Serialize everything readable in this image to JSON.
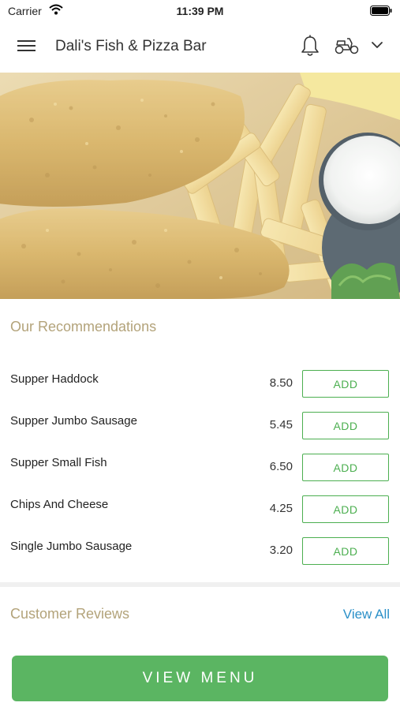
{
  "status_bar": {
    "carrier": "Carrier",
    "time": "11:39 PM"
  },
  "app_bar": {
    "title": "Dali's Fish & Pizza Bar"
  },
  "recommendations": {
    "title": "Our Recommendations",
    "items": [
      {
        "name": "Supper Haddock",
        "price": "8.50",
        "button": "ADD"
      },
      {
        "name": "Supper Jumbo Sausage",
        "price": "5.45",
        "button": "ADD"
      },
      {
        "name": "Supper Small Fish",
        "price": "6.50",
        "button": "ADD"
      },
      {
        "name": "Chips And Cheese",
        "price": "4.25",
        "button": "ADD"
      },
      {
        "name": "Single Jumbo Sausage",
        "price": "3.20",
        "button": "ADD"
      }
    ]
  },
  "reviews": {
    "title": "Customer Reviews",
    "view_all": "View All"
  },
  "footer": {
    "view_menu": "VIEW MENU"
  },
  "colors": {
    "accent_green": "#5bb562",
    "section_title": "#b3a37a",
    "link_blue": "#2b90c8"
  }
}
